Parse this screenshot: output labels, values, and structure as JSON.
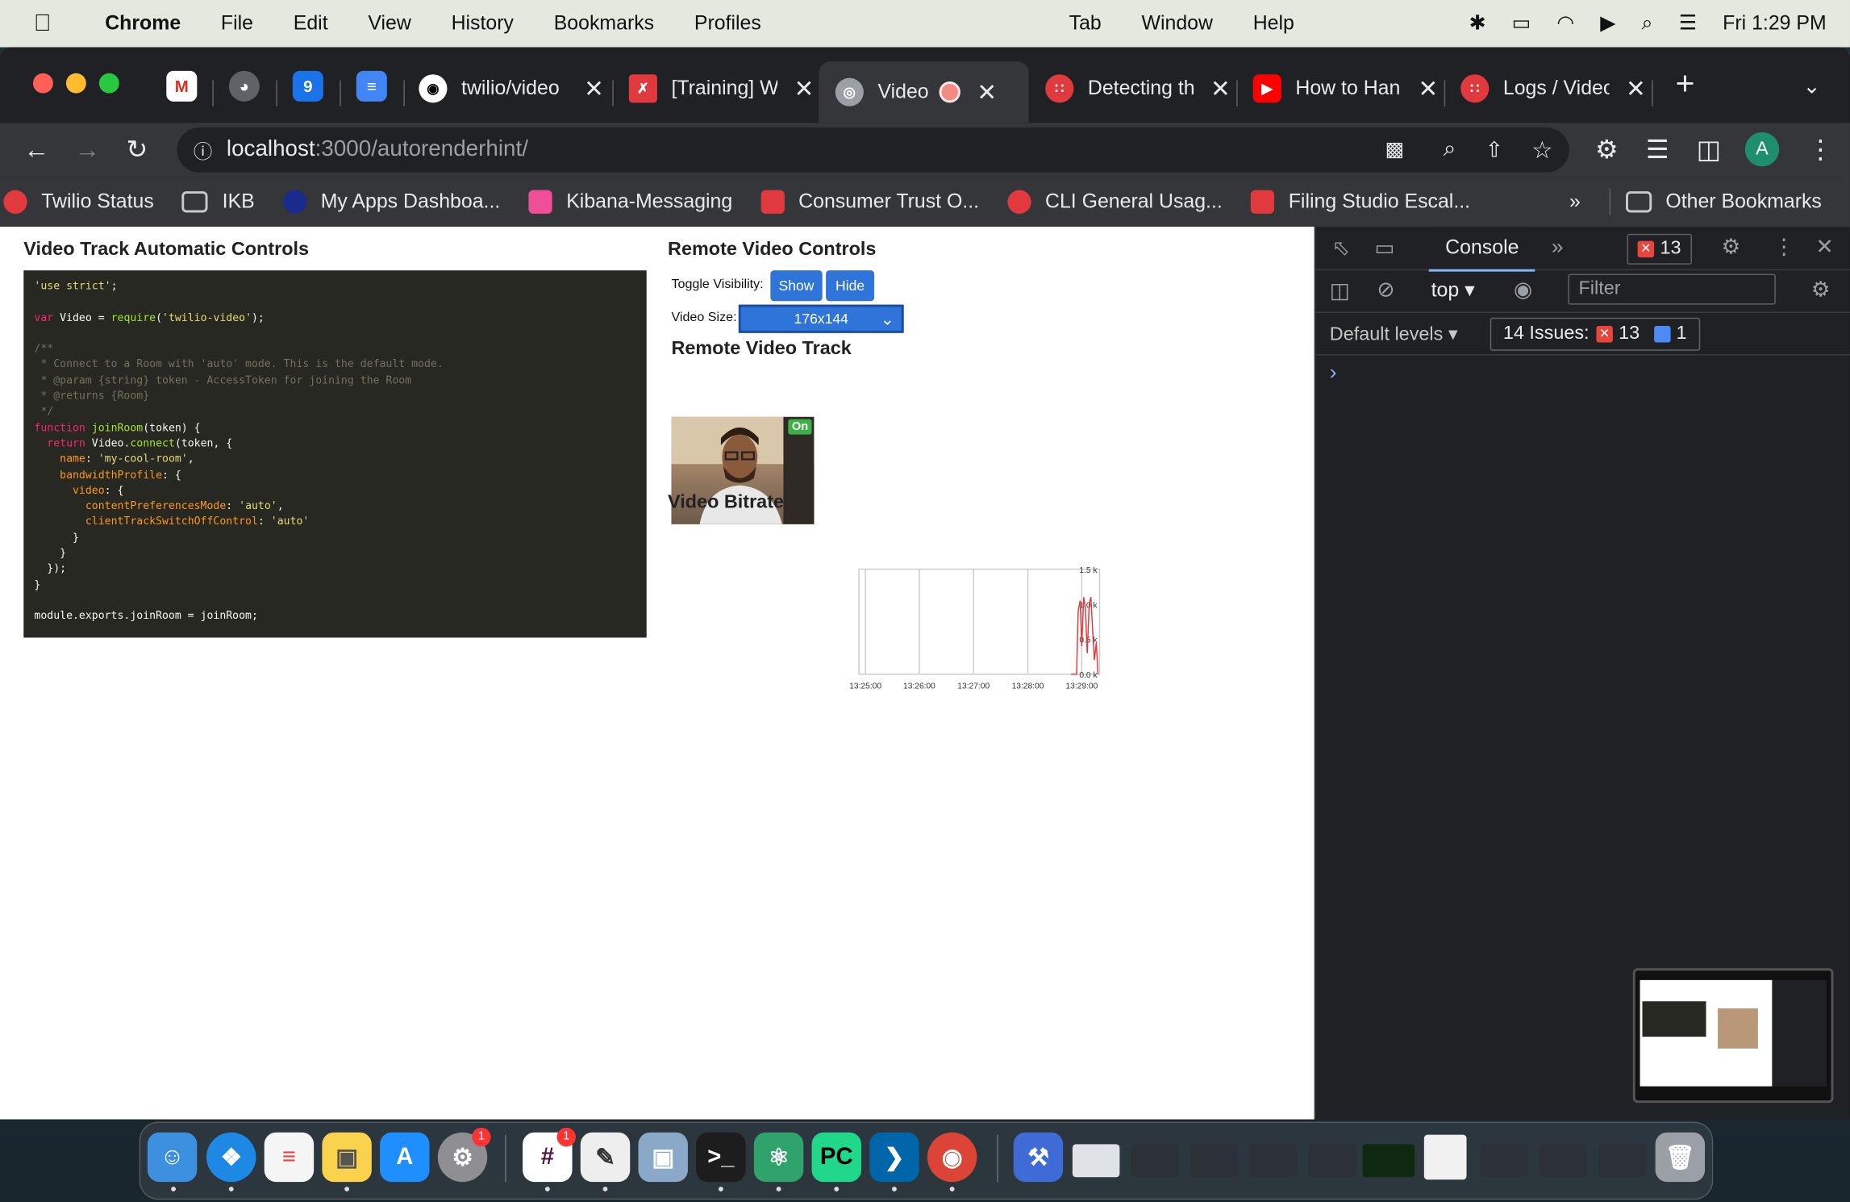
{
  "menubar": {
    "app_name": "Chrome",
    "items": [
      "File",
      "Edit",
      "View",
      "History",
      "Bookmarks",
      "Profiles",
      "Tab",
      "Window",
      "Help"
    ],
    "clock": "Fri  1:29 PM"
  },
  "tabs": [
    {
      "title": "twilio/video",
      "icon": "github-icon"
    },
    {
      "title": "[Training] W",
      "icon": "training-icon"
    },
    {
      "title": "Video T",
      "icon": "globe-icon",
      "active": true
    },
    {
      "title": "Detecting th",
      "icon": "twilio-icon"
    },
    {
      "title": "How to Han",
      "icon": "youtube-icon"
    },
    {
      "title": "Logs / Video",
      "icon": "twilio-icon"
    }
  ],
  "omnibox": {
    "host": "localhost",
    "path": ":3000/autorenderhint/"
  },
  "profile_initial": "A",
  "bookmarks": {
    "items": [
      {
        "label": "Twilio Status",
        "color": "#e03a3e"
      },
      {
        "label": "IKB",
        "color": "folder"
      },
      {
        "label": "My Apps Dashboa...",
        "color": "#1a2b8c"
      },
      {
        "label": "Kibana-Messaging",
        "color": "#f04e98"
      },
      {
        "label": "Consumer Trust O...",
        "color": "#e03a3e"
      },
      {
        "label": "CLI General Usag...",
        "color": "#e03a3e"
      },
      {
        "label": "Filing Studio Escal...",
        "color": "#e03a3e"
      }
    ],
    "overflow": "»",
    "other": "Other Bookmarks"
  },
  "page": {
    "left_heading": "Video Track Automatic Controls",
    "remote_heading": "Remote Video Controls",
    "toggle_label": "Toggle Visibility:",
    "show_button": "Show",
    "hide_button": "Hide",
    "size_label": "Video Size:",
    "size_value": "176x144",
    "track_heading": "Remote Video Track",
    "video_badge": "On",
    "bitrate_heading": "Video Bitrate",
    "code_lines": [
      "'use strict';",
      "",
      "var Video = require('twilio-video');",
      "",
      "/**",
      " * Connect to a Room with 'auto' mode. This is the default mode.",
      " * @param {string} token - AccessToken for joining the Room",
      " * @returns {Room}",
      " */",
      "function joinRoom(token) {",
      "  return Video.connect(token, {",
      "    name: 'my-cool-room',",
      "    bandwidthProfile: {",
      "      video: {",
      "        contentPreferencesMode: 'auto',",
      "        clientTrackSwitchOffControl: 'auto'",
      "      }",
      "    }",
      "  });",
      "}",
      "",
      "module.exports.joinRoom = joinRoom;"
    ]
  },
  "chart_data": {
    "type": "line",
    "x_ticks": [
      "13:25:00",
      "13:26:00",
      "13:27:00",
      "13:28:00",
      "13:29:00"
    ],
    "y_ticks": [
      "0.0 k",
      "0.5 k",
      "1.0 k",
      "1.5 k"
    ],
    "ylim": [
      0,
      1.5
    ],
    "series": [
      {
        "color": "#e03a3e",
        "x": [
          13.48,
          13.4817,
          13.4822,
          13.4828,
          13.4833,
          13.4839,
          13.4844,
          13.485,
          13.4856,
          13.4861,
          13.4867,
          13.4872,
          13.4878,
          13.4883
        ],
        "y": [
          0.0,
          0.0,
          0.9,
          1.05,
          0.4,
          1.1,
          0.95,
          0.3,
          1.0,
          1.1,
          0.6,
          0.2,
          0.45,
          0.0
        ]
      }
    ],
    "grid": true
  },
  "devtools": {
    "tab": "Console",
    "error_count": "13",
    "context": "top",
    "filter_placeholder": "Filter",
    "levels": "Default levels",
    "issues_label": "14 Issues:",
    "issues_errors": "13",
    "issues_info": "1",
    "prompt": "›"
  },
  "dock": {
    "slack_badge": "1",
    "settings_badge": "1"
  }
}
